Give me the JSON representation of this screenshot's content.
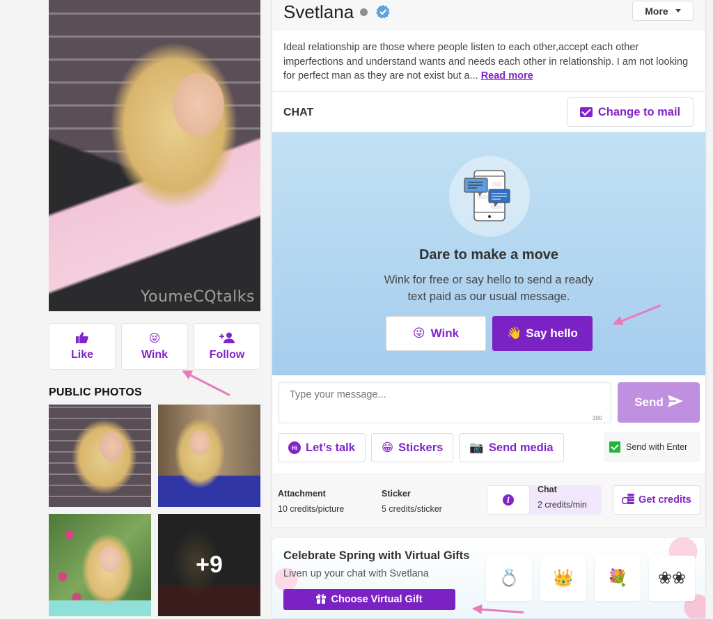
{
  "profile": {
    "name": "Svetlana",
    "online_status": "offline",
    "verified": true,
    "more_label": "More",
    "about": "Ideal relationship are those where people listen to each other,accept each other imperfections and understand wants and needs each other in relationship. I am not looking for perfect man as they are not exist but a...",
    "read_more_label": "Read more",
    "main_photo_watermark": "YoumeCQtalks"
  },
  "actions": [
    {
      "label": "Like",
      "icon": "thumbs-up-icon"
    },
    {
      "label": "Wink",
      "icon": "wink-emoji-icon"
    },
    {
      "label": "Follow",
      "icon": "user-plus-icon"
    }
  ],
  "public_photos": {
    "title": "PUBLIC PHOTOS",
    "more_count": "+9"
  },
  "chat": {
    "label": "CHAT",
    "change_mode_label": "Change to mail",
    "hero_title": "Dare to make a move",
    "hero_subtitle": "Wink for free or say hello to send a ready text paid as our usual message.",
    "wink_label": "Wink",
    "say_hello_label": "Say hello",
    "input_placeholder": "Type your message...",
    "char_limit": "300",
    "send_label": "Send",
    "tools": [
      {
        "label": "Let’s talk",
        "icon": "hi-bubble-icon"
      },
      {
        "label": "Stickers",
        "icon": "sticker-emoji-icon"
      },
      {
        "label": "Send media",
        "icon": "camera-icon"
      }
    ],
    "send_with_enter_label": "Send with Enter",
    "send_with_enter_checked": true
  },
  "pricing": {
    "attachment": {
      "label": "Attachment",
      "value": "10 credits/picture"
    },
    "sticker": {
      "label": "Sticker",
      "value": "5 credits/sticker"
    },
    "chat": {
      "label": "Chat",
      "value": "2 credits/min"
    },
    "get_credits_label": "Get credits"
  },
  "gift_banner": {
    "title": "Celebrate Spring with Virtual Gifts",
    "subtitle": "Liven up your chat with Svetlana",
    "button_label": "Choose Virtual Gift",
    "items": [
      "ring",
      "crown",
      "bouquet",
      "earrings"
    ]
  },
  "colors": {
    "accent": "#8224c8",
    "button_primary": "#7b22c4",
    "send_disabled": "#bf8fe0",
    "hero_bg": "#b4d7f1",
    "annotation_arrow": "#e77bb9"
  }
}
